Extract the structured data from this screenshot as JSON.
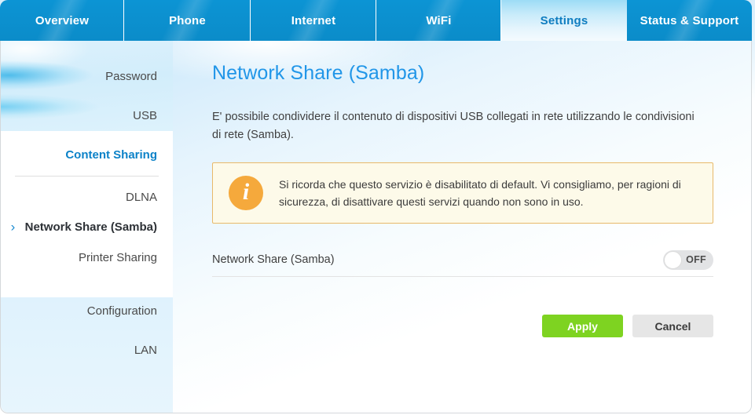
{
  "tabs": [
    {
      "label": "Overview",
      "active": false
    },
    {
      "label": "Phone",
      "active": false
    },
    {
      "label": "Internet",
      "active": false
    },
    {
      "label": "WiFi",
      "active": false
    },
    {
      "label": "Settings",
      "active": true
    },
    {
      "label": "Status & Support",
      "active": false
    }
  ],
  "sidebar": {
    "items": [
      {
        "label": "Password",
        "type": "link"
      },
      {
        "label": "USB",
        "type": "link"
      },
      {
        "label": "Content Sharing",
        "type": "section"
      },
      {
        "label": "DLNA",
        "type": "link"
      },
      {
        "label": "Network Share (Samba)",
        "type": "current"
      },
      {
        "label": "Printer Sharing",
        "type": "link"
      },
      {
        "label": "Configuration",
        "type": "link"
      },
      {
        "label": "LAN",
        "type": "link"
      }
    ],
    "chevron_glyph": "›"
  },
  "main": {
    "title": "Network Share (Samba)",
    "description": "E' possibile condividere il contenuto di dispositivi USB collegati in rete utilizzando le condivisioni di rete (Samba).",
    "notice": {
      "icon_glyph": "i",
      "text": "Si ricorda che questo servizio è disabilitato di default. Vi consigliamo, per ragioni di sicurezza, di disattivare questi servizi quando non sono in uso."
    },
    "toggle": {
      "label": "Network Share (Samba)",
      "state": "OFF"
    },
    "buttons": {
      "apply": "Apply",
      "cancel": "Cancel"
    }
  },
  "colors": {
    "tab_blue": "#0b8cc9",
    "accent_blue": "#2196e8",
    "apply_green": "#7ed321",
    "notice_border": "#e8b96a",
    "notice_bg": "#fdfae9",
    "info_icon_orange": "#f5a93c"
  }
}
